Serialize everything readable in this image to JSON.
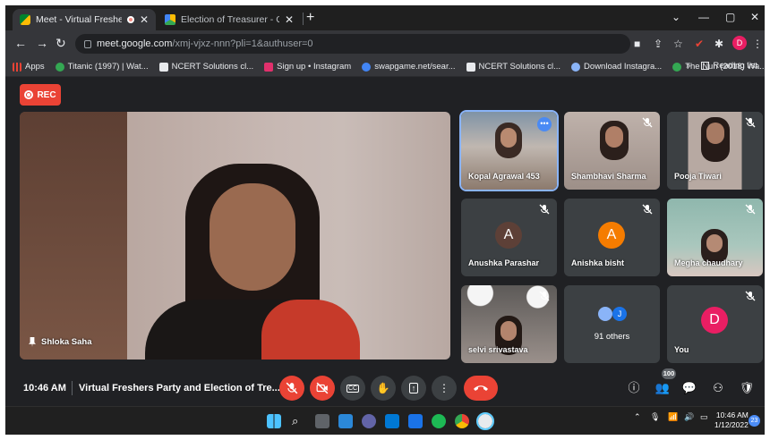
{
  "browser": {
    "tabs": [
      {
        "title": "Meet - Virtual Freshers Party",
        "active": true
      },
      {
        "title": "Election of Treasurer - Google Docs",
        "active": false
      }
    ],
    "new_tab": "+",
    "window_controls": {
      "minimize": "—",
      "restore": "▢",
      "close": "✕"
    },
    "url": {
      "host": "meet.google.com",
      "path": "/xmj-vjxz-nnn?pli=1&authuser=0"
    },
    "profile_initial": "D",
    "bookmarks": [
      {
        "label": "Apps",
        "color": "#ea4335"
      },
      {
        "label": "Titanic (1997) | Wat...",
        "color": "#34a853"
      },
      {
        "label": "NCERT Solutions cl...",
        "color": "#ffffff"
      },
      {
        "label": "Sign up • Instagram",
        "color": "#e1306c"
      },
      {
        "label": "swapgame.net/sear...",
        "color": "#4285f4"
      },
      {
        "label": "NCERT Solutions cl...",
        "color": "#ffffff"
      },
      {
        "label": "Download Instagra...",
        "color": "#8ab4f8"
      },
      {
        "label": "The Nun (2018) Wa...",
        "color": "#34a853"
      }
    ],
    "bookmarks_overflow": "»",
    "reading_list": "Reading list"
  },
  "meet": {
    "rec_label": "REC",
    "main_speaker": {
      "name": "Shloka Saha"
    },
    "tiles": [
      {
        "name": "Kopal Agrawal 453",
        "type": "video",
        "muted": false,
        "speaking": true
      },
      {
        "name": "Shambhavi Sharma",
        "type": "video",
        "muted": true
      },
      {
        "name": "Pooja Tiwari",
        "type": "video",
        "muted": true
      },
      {
        "name": "Anushka Parashar",
        "type": "avatar",
        "initial": "A",
        "color": "#5d4037",
        "muted": true
      },
      {
        "name": "Anishka bisht",
        "type": "avatar",
        "initial": "A",
        "color": "#f57c00",
        "muted": true
      },
      {
        "name": "Megha chaudhary",
        "type": "video",
        "muted": true
      },
      {
        "name": "selvi srivastava",
        "type": "video",
        "muted": true
      },
      {
        "name": "91 others",
        "type": "others",
        "mini_initial": "J"
      },
      {
        "name": "You",
        "type": "avatar",
        "initial": "D",
        "color": "#e91e63",
        "muted": true
      }
    ],
    "bottom_bar": {
      "time": "10:46 AM",
      "meeting_title": "Virtual Freshers Party and Election of Tre...",
      "participants_count": "100"
    }
  },
  "taskbar": {
    "tray_time": "10:46 AM",
    "tray_date": "1/12/2022",
    "notifications": "23"
  }
}
